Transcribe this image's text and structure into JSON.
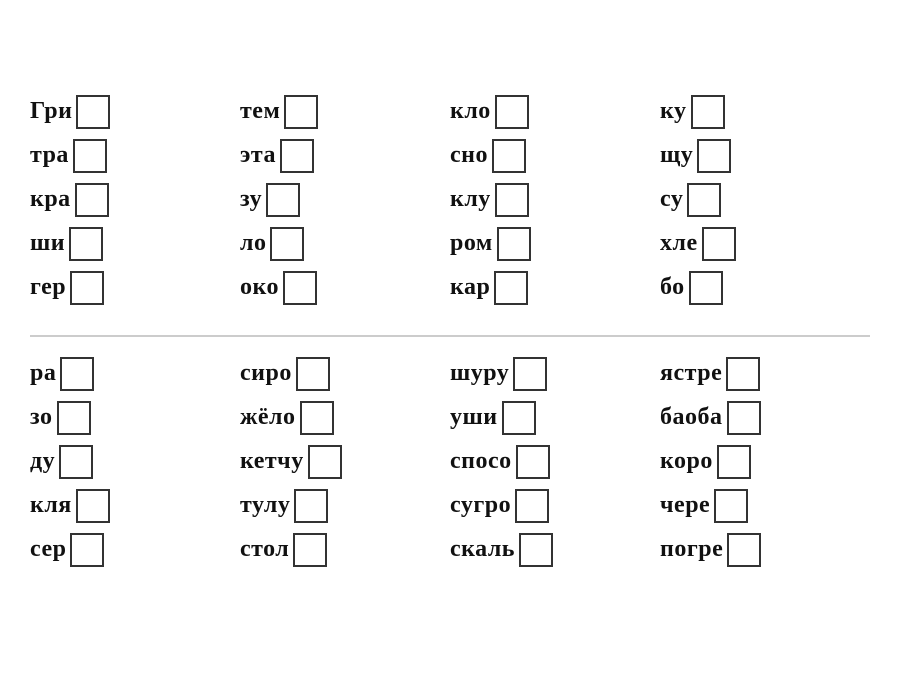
{
  "section1": {
    "columns": [
      {
        "id": "col1",
        "items": [
          "Гри",
          "тра",
          "кра",
          "ши",
          "гер"
        ]
      },
      {
        "id": "col2",
        "items": [
          "тем",
          "эта",
          "зу",
          "ло",
          "око"
        ]
      },
      {
        "id": "col3",
        "items": [
          "кло",
          "сно",
          "клу",
          "ром",
          "кар"
        ]
      },
      {
        "id": "col4",
        "items": [
          "ку",
          "щу",
          "су",
          "хле",
          "бо"
        ]
      }
    ]
  },
  "section2": {
    "columns": [
      {
        "id": "col5",
        "items": [
          "ра",
          "зо",
          "ду",
          "кля",
          "сер"
        ]
      },
      {
        "id": "col6",
        "items": [
          "сиро",
          "жёло",
          "кетчу",
          "тулу",
          "стол"
        ]
      },
      {
        "id": "col7",
        "items": [
          "шуру",
          "уши",
          "спосо",
          "сугро",
          "скаль"
        ]
      },
      {
        "id": "col8",
        "items": [
          "ястре",
          "баоба",
          "коро",
          "чере",
          "погре"
        ]
      }
    ]
  }
}
